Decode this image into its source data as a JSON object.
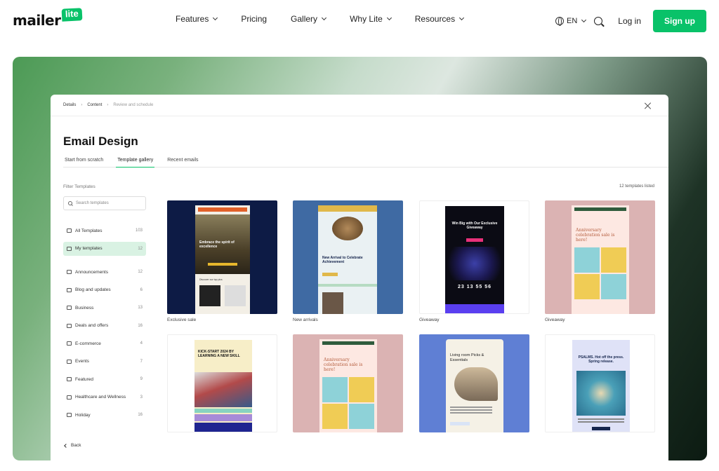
{
  "nav": {
    "logo_text": "mailer",
    "logo_badge": "lite",
    "links": [
      "Features",
      "Pricing",
      "Gallery",
      "Why Lite",
      "Resources"
    ],
    "lang": "EN",
    "login": "Log in",
    "signup": "Sign up"
  },
  "modal": {
    "breadcrumb": [
      "Details",
      "Content",
      "Review and schedule"
    ],
    "title": "Email Design",
    "tabs": [
      "Start from scratch",
      "Template gallery",
      "Recent emails"
    ],
    "filter_label": "Filter Templates",
    "count_label": "12 templates listed",
    "search_placeholder": "Search templates",
    "categories": [
      {
        "label": "All Templates",
        "count": "103"
      },
      {
        "label": "My templates",
        "count": "12"
      },
      {
        "label": "Announcements",
        "count": "12"
      },
      {
        "label": "Blog and updates",
        "count": "6"
      },
      {
        "label": "Business",
        "count": "13"
      },
      {
        "label": "Deals and offers",
        "count": "16"
      },
      {
        "label": "E-commerce",
        "count": "4"
      },
      {
        "label": "Events",
        "count": "7"
      },
      {
        "label": "Featured",
        "count": "9"
      },
      {
        "label": "Healthcare and Wellness",
        "count": "3"
      },
      {
        "label": "Holiday",
        "count": "16"
      }
    ],
    "back": "Back"
  },
  "templates": [
    {
      "name": "Exclusive sale",
      "headline": "Embrace the spirit of excellence",
      "sub": "Discover our top pics"
    },
    {
      "name": "New arrivals",
      "headline": "New Arrival to Celebrate Achievement"
    },
    {
      "name": "Giveaway",
      "headline": "Win Big with Our Exclusive Giveaway",
      "countdown": "23 13 55 56"
    },
    {
      "name": "Giveaway",
      "headline": "Anniversary celebration sale is here!"
    },
    {
      "name": "",
      "headline": "KICK-START 2024 BY LEARNING A NEW SKILL"
    },
    {
      "name": "",
      "headline": "Anniversary celebration sale is here!"
    },
    {
      "name": "",
      "headline": "Living room Picks & Essentials"
    },
    {
      "name": "",
      "headline": "PSALMS. Hot off the press. Spring release."
    }
  ]
}
